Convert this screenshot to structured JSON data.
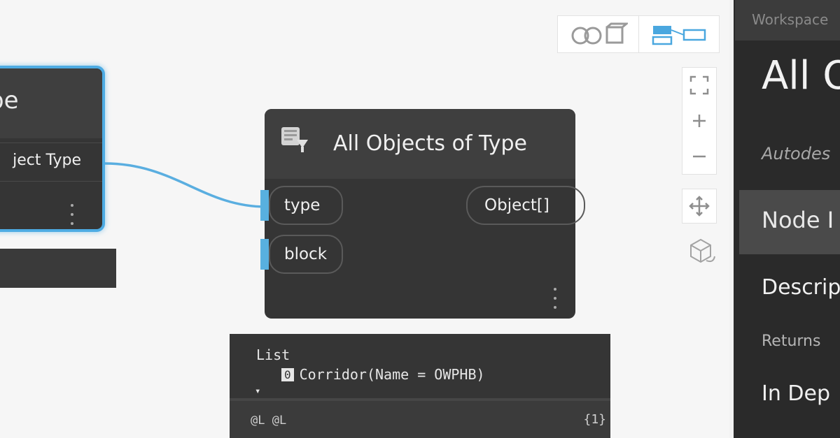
{
  "left_node": {
    "title_fragment": "pe",
    "output_label": "ject Type"
  },
  "main_node": {
    "title": "All Objects of Type",
    "inputs": [
      {
        "label": "type"
      },
      {
        "label": "block"
      }
    ],
    "output": {
      "label": "Object[]"
    }
  },
  "preview": {
    "line1": "List",
    "index": "0",
    "item": "Corridor(Name = OWPHB)",
    "levels": "@L @L",
    "count": "{1}"
  },
  "panel": {
    "tab_label": "Workspace",
    "heading": "All O",
    "subtitle": "Autodes",
    "band_label": "Node I",
    "description_label": "Descrip",
    "returns_label": "Returns",
    "in_depth_label": "In Dep"
  },
  "colors": {
    "accent": "#58b0df",
    "node_body": "#353535",
    "node_header": "#3f3f3f",
    "canvas": "#f6f6f6",
    "panel": "#2a2a2a"
  },
  "icons": [
    "node-type-icon",
    "geometry-view-icon",
    "graph-view-icon",
    "zoom-fit-icon",
    "zoom-in-icon",
    "zoom-out-icon",
    "pan-icon",
    "orbit-icon"
  ]
}
